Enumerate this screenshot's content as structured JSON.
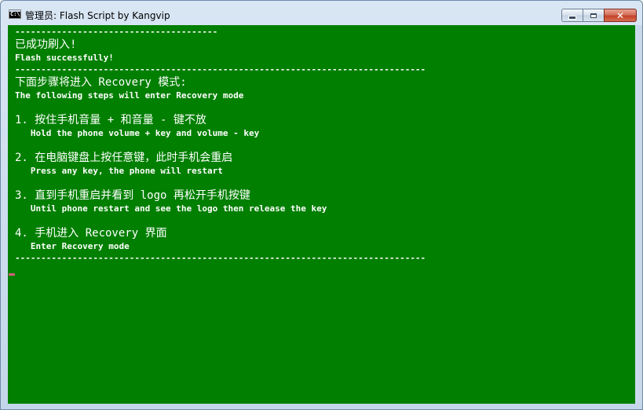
{
  "window": {
    "title": "管理员: Flash Script by Kangvip",
    "icon_text": "C:\\",
    "minimize_label": "",
    "maximize_label": "",
    "close_label": "✕"
  },
  "console": {
    "lines": [
      "---------------------------------------",
      "已成功刷入!",
      "Flash successfully!",
      "-------------------------------------------------------------------------------",
      "下面步骤将进入 Recovery 模式:",
      "The following steps will enter Recovery mode",
      "1. 按住手机音量 + 和音量 - 键不放",
      "   Hold the phone volume + key and volume - key",
      "2. 在电脑键盘上按任意键，此时手机会重启",
      "   Press any key, the phone will restart",
      "3. 直到手机重启并看到 logo 再松开手机按键",
      "   Until phone restart and see the logo then release the key",
      "4. 手机进入 Recovery 界面",
      "   Enter Recovery mode",
      "-------------------------------------------------------------------------------"
    ]
  },
  "colors": {
    "console_bg": "#007f00",
    "console_fg": "#ffffff",
    "cursor": "#d0607a"
  }
}
